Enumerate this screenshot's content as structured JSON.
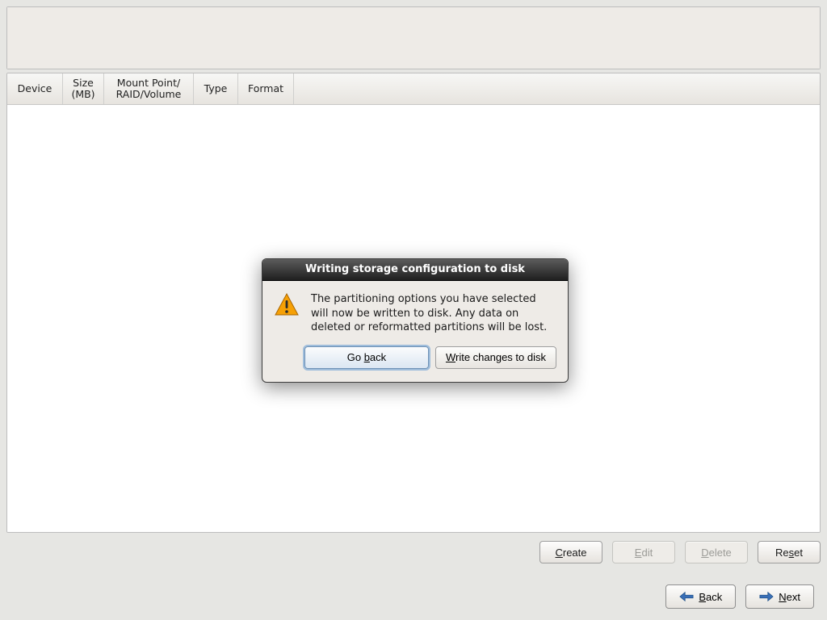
{
  "columns": {
    "device": "Device",
    "size": "Size\n(MB)",
    "mount": "Mount Point/\nRAID/Volume",
    "type": "Type",
    "format": "Format"
  },
  "actions": {
    "create": {
      "pre": "",
      "av": "C",
      "post": "reate",
      "enabled": true
    },
    "edit": {
      "pre": "",
      "av": "E",
      "post": "dit",
      "enabled": false
    },
    "delete": {
      "pre": "",
      "av": "D",
      "post": "elete",
      "enabled": false
    },
    "reset": {
      "pre": "Re",
      "av": "s",
      "post": "et",
      "enabled": true
    }
  },
  "nav": {
    "back": {
      "av": "B",
      "post": "ack"
    },
    "next": {
      "av": "N",
      "post": "ext"
    }
  },
  "dialog": {
    "title": "Writing storage configuration to disk",
    "message": "The partitioning options you have selected will now be written to disk.  Any data on deleted or reformatted partitions will be lost.",
    "go_back": {
      "pre": "Go ",
      "av": "b",
      "post": "ack"
    },
    "write": {
      "pre": "",
      "av": "W",
      "post": "rite changes to disk"
    }
  },
  "colors": {
    "arrow_back": "#3a6fb6",
    "arrow_next": "#3a6fb6",
    "warn_fill": "#f6a005",
    "warn_stroke": "#c97f00"
  }
}
